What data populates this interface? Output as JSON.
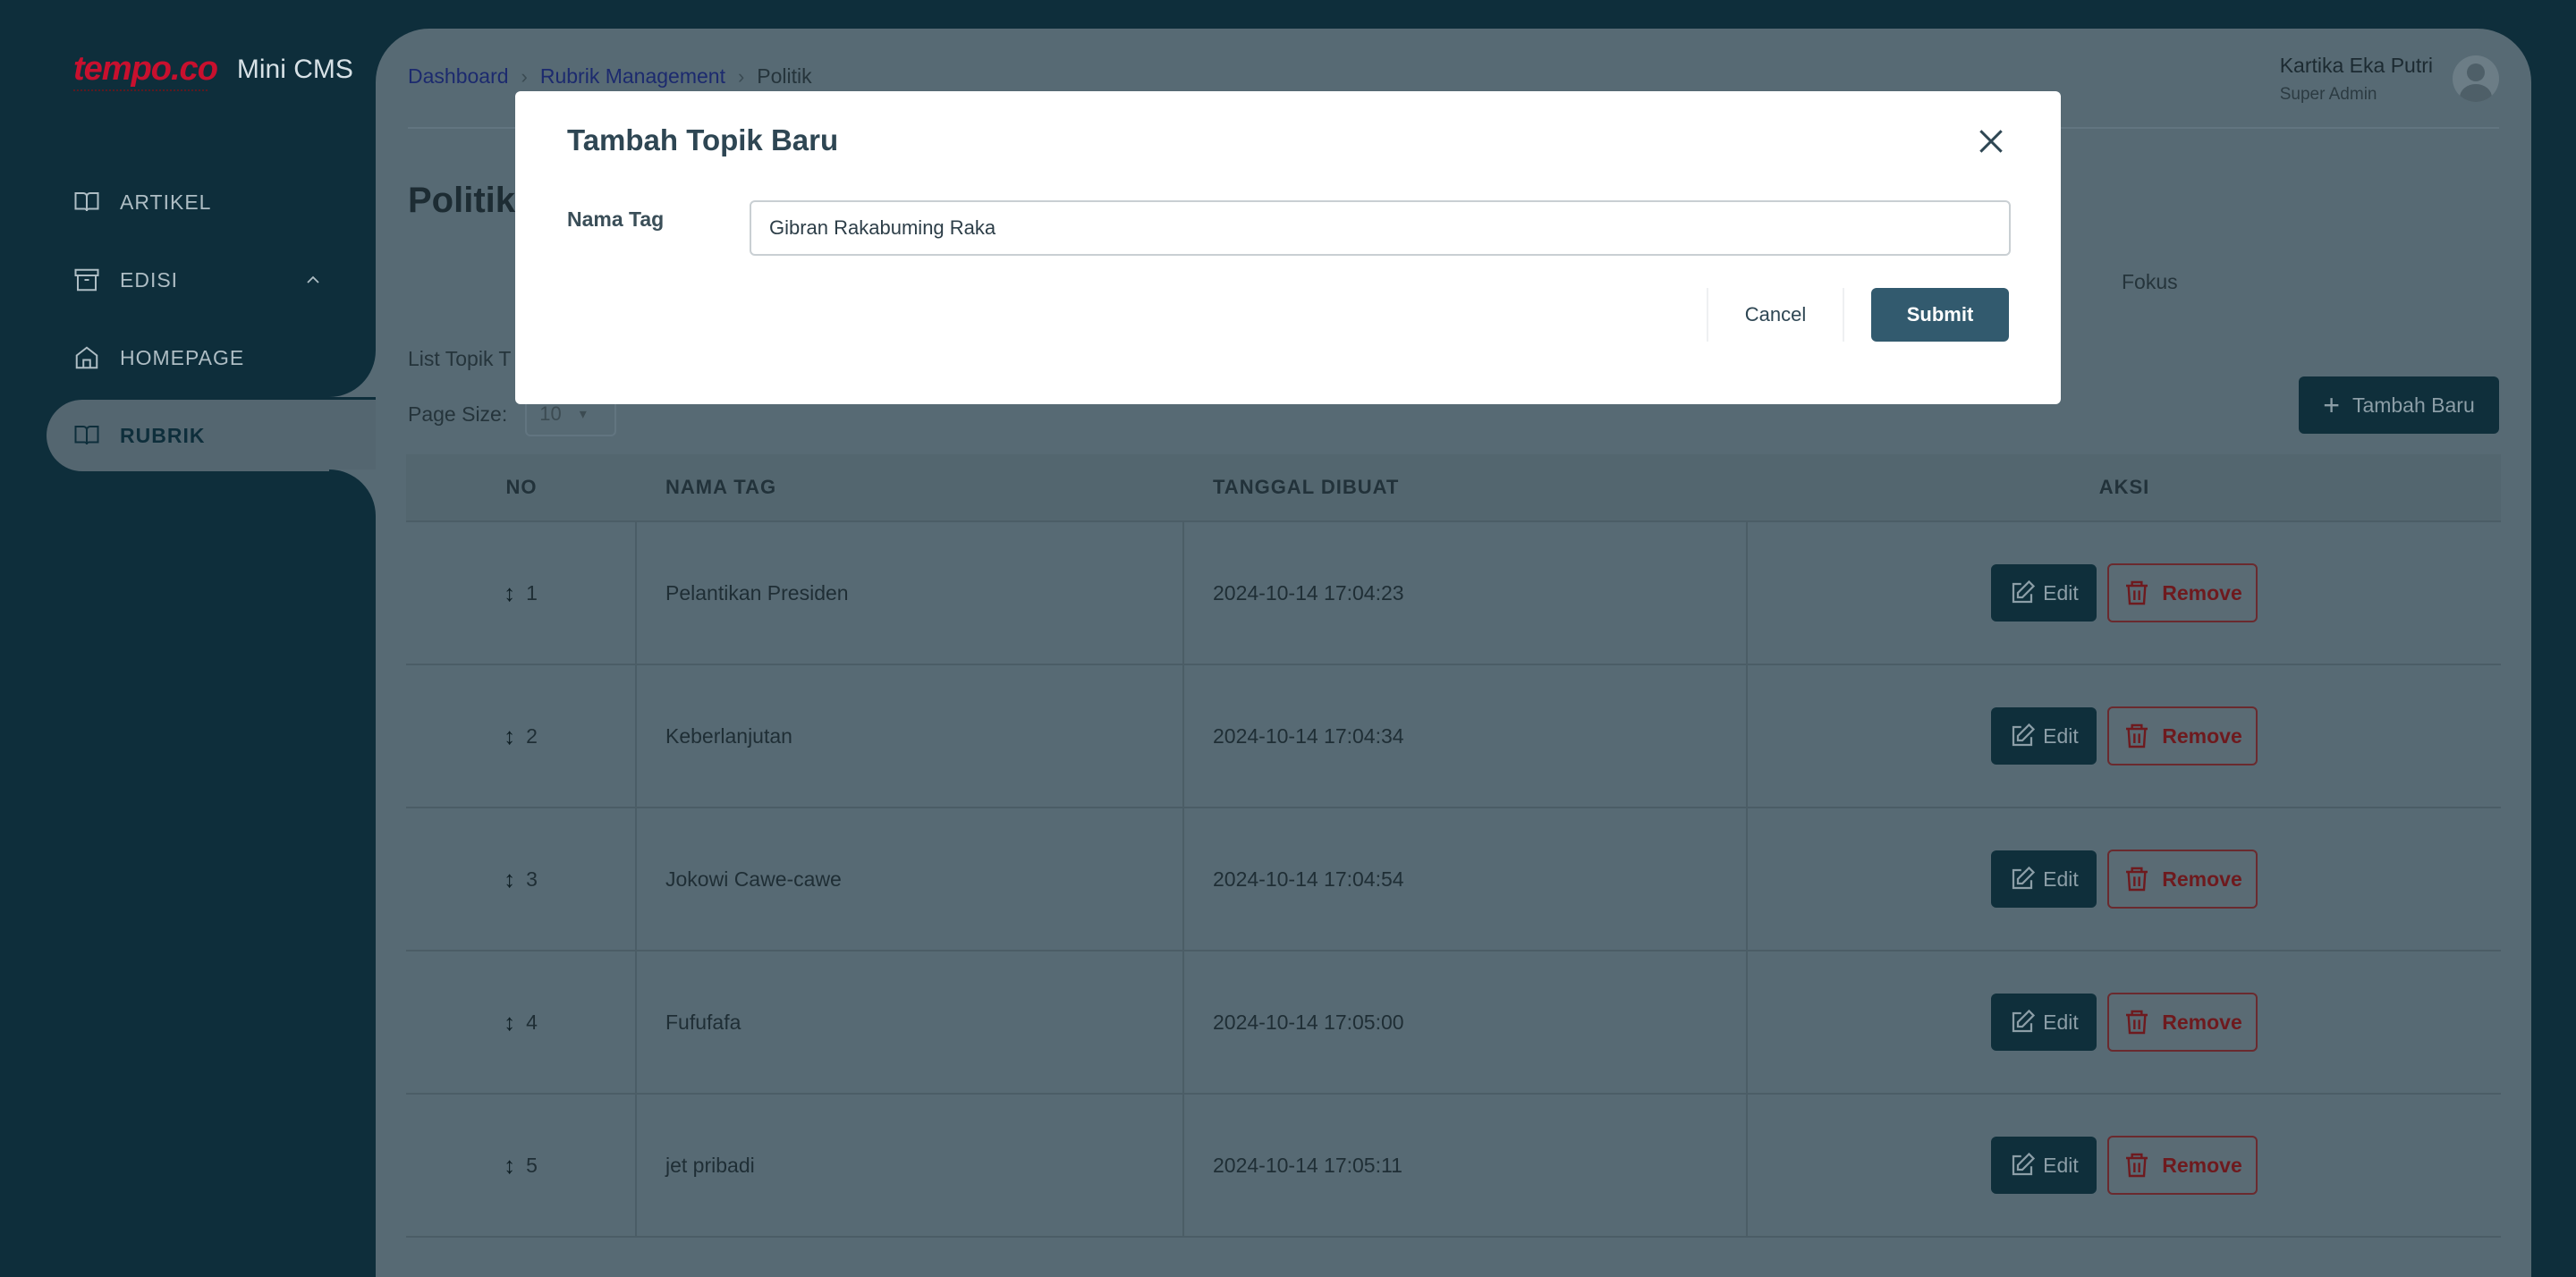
{
  "sidebar": {
    "logo": "tempo.co",
    "app_title": "Mini CMS",
    "items": [
      {
        "label": "ARTIKEL",
        "icon": "book-icon"
      },
      {
        "label": "EDISI",
        "icon": "archive-icon"
      },
      {
        "label": "HOMEPAGE",
        "icon": "home-icon"
      },
      {
        "label": "RUBRIK",
        "icon": "book-icon",
        "active": true
      }
    ]
  },
  "header": {
    "breadcrumb": [
      "Dashboard",
      "Rubrik Management",
      "Politik"
    ],
    "user_name": "Kartika Eka Putri",
    "user_role": "Super Admin"
  },
  "main": {
    "page_title": "Politik",
    "tab_visible": "Fokus",
    "list_title": "List Topik T",
    "page_size_label": "Page Size:",
    "page_size_value": "10",
    "add_button": "Tambah Baru",
    "table": {
      "headers": [
        "NO",
        "NAMA TAG",
        "TANGGAL DIBUAT",
        "AKSI"
      ],
      "rows": [
        {
          "no": "1",
          "nama": "Pelantikan Presiden",
          "tanggal": "2024-10-14 17:04:23"
        },
        {
          "no": "2",
          "nama": "Keberlanjutan",
          "tanggal": "2024-10-14 17:04:34"
        },
        {
          "no": "3",
          "nama": "Jokowi Cawe-cawe",
          "tanggal": "2024-10-14 17:04:54"
        },
        {
          "no": "4",
          "nama": "Fufufafa",
          "tanggal": "2024-10-14 17:05:00"
        },
        {
          "no": "5",
          "nama": "jet pribadi",
          "tanggal": "2024-10-14 17:05:11"
        }
      ],
      "edit_label": "Edit",
      "remove_label": "Remove"
    }
  },
  "modal": {
    "title": "Tambah Topik Baru",
    "field_label": "Nama Tag",
    "field_value": "Gibran Rakabuming Raka",
    "cancel_label": "Cancel",
    "submit_label": "Submit"
  },
  "colors": {
    "sidebar_bg": "#0e2e3b",
    "primary": "#325a6e",
    "danger": "#c8102e",
    "overlay_panel": "#576a74"
  }
}
